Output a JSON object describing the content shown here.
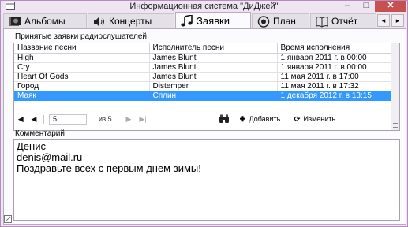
{
  "window": {
    "title": "Информационная система \"ДиДжей\"",
    "controls": {
      "minimize": "–",
      "maximize": "□",
      "close": "✕"
    }
  },
  "tabs": [
    {
      "label": "Альбомы",
      "icon": "album-icon",
      "active": false
    },
    {
      "label": "Концерты",
      "icon": "speaker-icon",
      "active": false
    },
    {
      "label": "Заявки",
      "icon": "music-note-icon",
      "active": true
    },
    {
      "label": "План",
      "icon": "record-icon",
      "active": false
    },
    {
      "label": "Отчёт",
      "icon": "book-icon",
      "active": false
    }
  ],
  "tab_scroll": {
    "left": "◂",
    "right": "▸"
  },
  "requests": {
    "section_label": "Принятые заявки радиослушателей",
    "columns": [
      "Название песни",
      "Исполнитель песни",
      "Время исполнения"
    ],
    "rows": [
      {
        "song": "High",
        "artist": "James Blunt",
        "time": "1 января 2011 г.   в 00:00",
        "selected": false
      },
      {
        "song": "Cry",
        "artist": "James Blunt",
        "time": "1 января 2011 г.   в 00:00",
        "selected": false
      },
      {
        "song": "Heart Of Gods",
        "artist": "James Blunt",
        "time": "11 мая 2011 г.   в 17:00",
        "selected": false
      },
      {
        "song": "Город",
        "artist": "Distemper",
        "time": "11 мая 2011 г.   в 17:32",
        "selected": false
      },
      {
        "song": "Маяк",
        "artist": "Сплин",
        "time": "1 декабря 2012 г.   в 13:15",
        "selected": true
      }
    ]
  },
  "navigator": {
    "first": "|◀",
    "prev": "◀",
    "position": "5",
    "of_text": "из 5",
    "next": "▶",
    "last": "▶|",
    "add_icon": "✚",
    "add_label": "Добавить",
    "edit_icon": "⟳",
    "edit_label": "Изменить"
  },
  "comment": {
    "label": "Комментарий",
    "lines": [
      "Денис",
      "denis@mail.ru",
      "Поздравьте всех с первым днем зимы!"
    ]
  },
  "colors": {
    "selection": "#3399ff",
    "close_button": "#c75050",
    "window_border": "#b78bbf"
  }
}
